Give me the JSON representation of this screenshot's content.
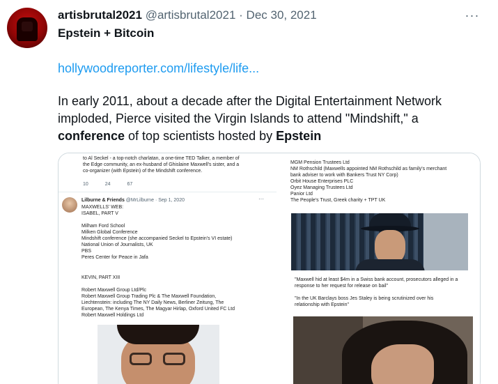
{
  "tweet": {
    "display_name": "artisbrutal2021",
    "handle": "@artisbrutal2021",
    "separator": "·",
    "date": "Dec 30, 2021",
    "title": "Epstein + Bitcoin",
    "link_text": "hollywoodreporter.com/lifestyle/life...",
    "body_part1": "In early 2011, about a decade after the Digital Entertainment Network imploded, Pierce visited the Virgin Islands to attend \"Mindshift,\" a ",
    "body_bold1": "conference",
    "body_part2": " of top scientists hosted by ",
    "body_bold2": "Epstein",
    "more_icon": "more-horizontal-icon",
    "more_glyph": "···"
  },
  "media": {
    "panel1": {
      "lines": [
        "to Al Seckel - a top-notch charlatan, a one-time TED Talker, a member of",
        "the Edge community, an ex-husband of Ghislaine Maxwell's sister, and a",
        "co-organizer (with Epstein) of the Mindshift conference."
      ],
      "stats": [
        "10",
        "24",
        "67"
      ],
      "quoted": {
        "name": "Lilburne & Friends",
        "handle": "@MrLilburne",
        "date": "Sep 1, 2020",
        "lines": [
          "MAXWELLS' WEB:",
          "ISABEL, PART V",
          "",
          "Milham Ford School",
          "Milken Global Conference",
          "Mindshift conference (she accompanied Seckel to Epstein's VI estate)",
          "National Union of Journalists, UK",
          "PBS",
          "Peres Center for Peace in Jafa"
        ]
      }
    },
    "panel2": {
      "lines": [
        "MGM Pension Trustees Ltd",
        "NM Rothschild (Maxwells appointed NM Rothschild as family's merchant",
        "bank adviser to work with Bankers Trust NY Corp)",
        "Orbit House Enterprises PLC",
        "Oyez Managing Trustees Ltd",
        "Panior Ltd",
        "The People's Trust, Greek charity + TPT UK"
      ]
    },
    "panel3": {
      "lines": [
        "KEVIN, PART XIII",
        "",
        "Robert Maxwell Group Ltd/Plc",
        "Robert Maxwell Group Trading Plc & The Maxwell Foundation,",
        "Liechtenstein: including The NY Daily News, Berliner Zeitung, The",
        "European, The Kenya Times, The Magyar Hirlap, Oxford United FC Ltd",
        "Robert Maxwell Holdings Ltd"
      ]
    },
    "panel4": {
      "lines": [
        "\"Maxwell hid at least $4m in a Swiss bank account, prosecutors alleged in a",
        "response to her request for release on bail\"",
        "",
        "\"In the UK Barclays boss Jes Staley is being scrutinized over his",
        "relationship with Epstein\""
      ]
    }
  }
}
